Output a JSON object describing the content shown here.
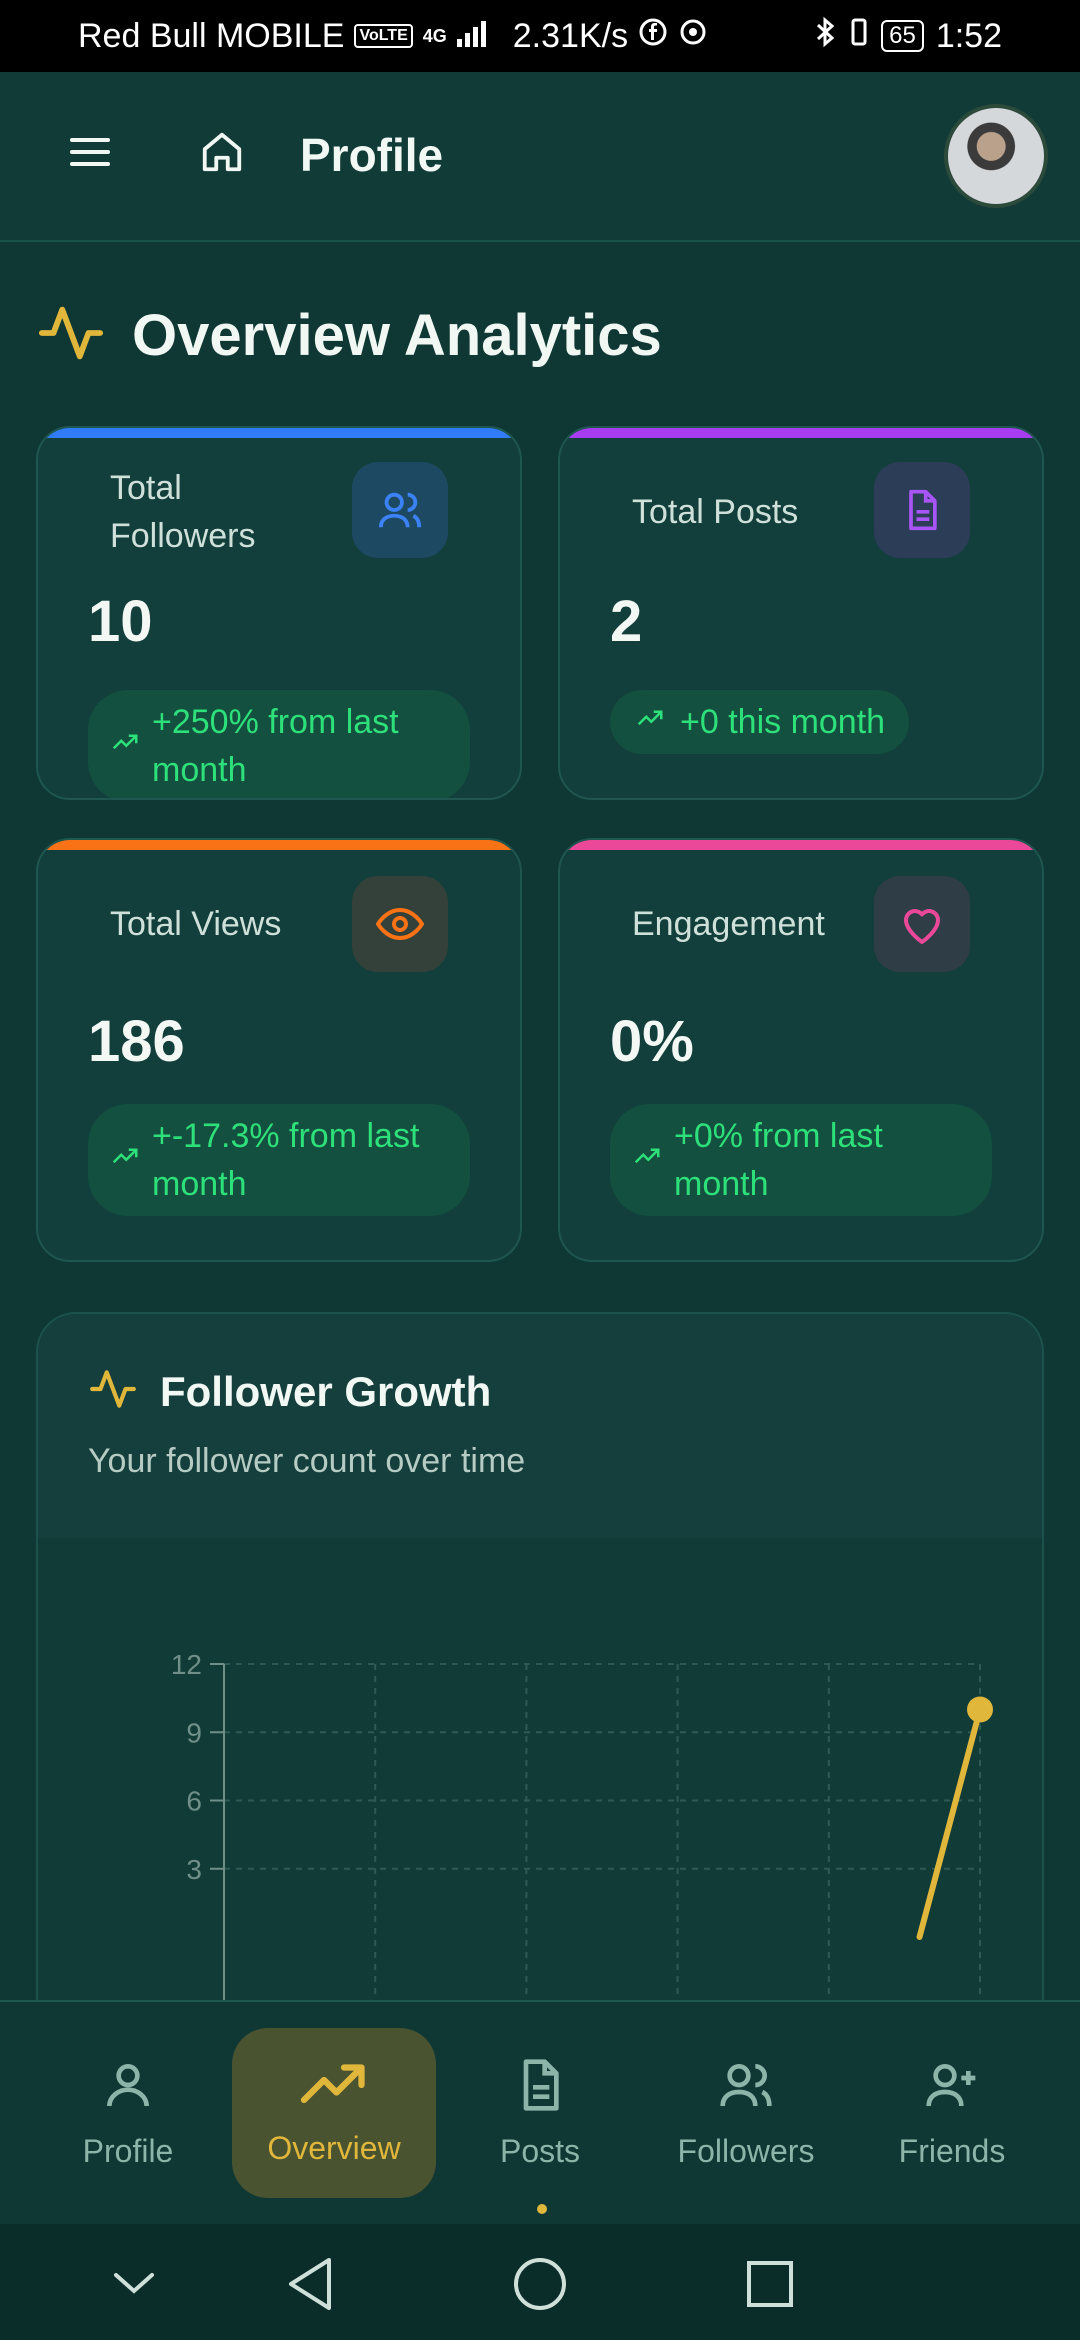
{
  "status_bar": {
    "carrier": "Red Bull MOBILE",
    "volte": "VoLTE",
    "network": "4G",
    "speed": "2.31K/s",
    "battery": "65",
    "time": "1:52"
  },
  "header": {
    "title": "Profile",
    "icons": [
      "menu-icon",
      "home-icon"
    ]
  },
  "overview": {
    "title": "Overview Analytics",
    "icon": "activity-icon"
  },
  "stats": [
    {
      "label": "Total Followers",
      "value": "10",
      "change": "+250% from last month",
      "icon": "users-icon",
      "accent": "#2f7cf6",
      "icon_color": "#3b82f6"
    },
    {
      "label": "Total Posts",
      "value": "2",
      "change": "+0 this month",
      "icon": "file-icon",
      "accent": "#a63df0",
      "icon_color": "#a855f7"
    },
    {
      "label": "Total Views",
      "value": "186",
      "change": "+-17.3% from last month",
      "icon": "eye-icon",
      "accent": "#f97316",
      "icon_color": "#f97316"
    },
    {
      "label": "Engagement",
      "value": "0%",
      "change": "+0% from last month",
      "icon": "heart-icon",
      "accent": "#ec4899",
      "icon_color": "#ec4899"
    }
  ],
  "growth": {
    "title": "Follower Growth",
    "subtitle": "Your follower count over time",
    "icon": "activity-icon"
  },
  "chart_data": {
    "type": "line",
    "title": "Follower Growth",
    "xlabel": "",
    "ylabel": "",
    "ylim": [
      0,
      12
    ],
    "y_ticks": [
      12,
      9,
      6,
      3
    ],
    "grid": true,
    "series": [
      {
        "values": [
          {
            "x": 4.6,
            "y": 0
          },
          {
            "x": 5,
            "y": 10
          }
        ]
      }
    ],
    "line_color": "#e0b63b"
  },
  "bottom_nav": {
    "items": [
      {
        "label": "Profile",
        "icon": "user-icon"
      },
      {
        "label": "Overview",
        "icon": "trending-up-icon"
      },
      {
        "label": "Posts",
        "icon": "file-icon"
      },
      {
        "label": "Followers",
        "icon": "users-icon"
      },
      {
        "label": "Friends",
        "icon": "user-plus-icon"
      }
    ],
    "active": "Overview"
  }
}
